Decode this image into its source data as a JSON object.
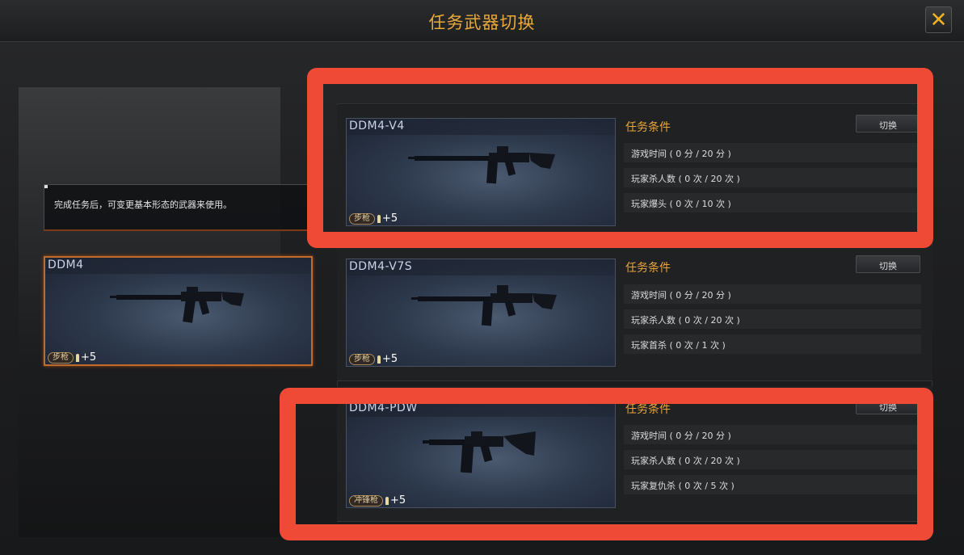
{
  "header": {
    "title": "任务武器切换"
  },
  "close_icon": "close-icon",
  "info_text": "完成任务后，可变更基本形态的武器来使用。",
  "selected_weapon": {
    "name": "DDM4",
    "tag": "步枪",
    "bonus": "+5"
  },
  "variants": [
    {
      "name": "DDM4-V4",
      "tag": "步枪",
      "bonus": "+5",
      "conditions_title": "任务条件",
      "switch_label": "切换",
      "conditions": [
        "游戏时间 ( 0 分 / 20 分 )",
        "玩家杀人数 ( 0 次 / 20 次 )",
        "玩家爆头 ( 0 次 / 10 次 )"
      ]
    },
    {
      "name": "DDM4-V7S",
      "tag": "步枪",
      "bonus": "+5",
      "conditions_title": "任务条件",
      "switch_label": "切换",
      "conditions": [
        "游戏时间 ( 0 分 / 20 分 )",
        "玩家杀人数 ( 0 次 / 20 次 )",
        "玩家首杀 ( 0 次 / 1 次 )"
      ]
    },
    {
      "name": "DDM4-PDW",
      "tag": "冲锋枪",
      "bonus": "+5",
      "conditions_title": "任务条件",
      "switch_label": "切换",
      "conditions": [
        "游戏时间 ( 0 分 / 20 分 )",
        "玩家杀人数 ( 0 次 / 20 次 )",
        "玩家复仇杀 ( 0 次 / 5 次 )"
      ]
    }
  ],
  "colors": {
    "accent": "#e9a93a",
    "highlight_frame": "#ee4a36",
    "selected_border": "#c06a2c"
  }
}
